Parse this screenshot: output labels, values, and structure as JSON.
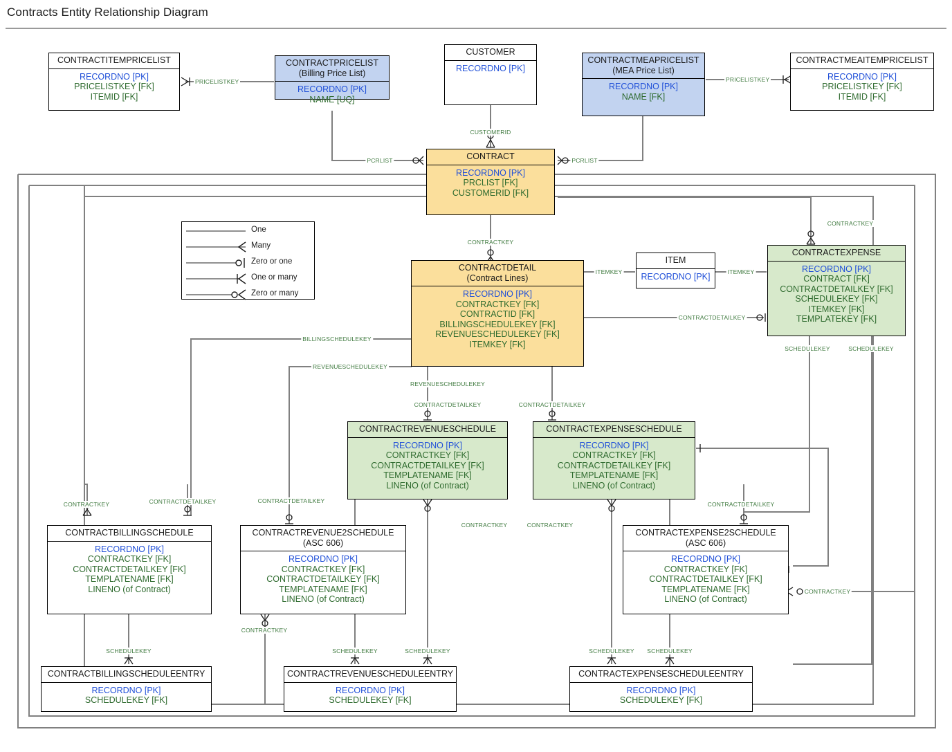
{
  "title": "Contracts Entity Relationship Diagram",
  "colors": {
    "pk": "#1f4fd8",
    "fk": "#2f6b2f",
    "label": "#3f7a3f",
    "blue_entity": "#c2d3f0",
    "orange_entity": "#fbdf9c",
    "green_entity": "#d7e9cb",
    "line": "#808080",
    "border": "#000000"
  },
  "legend": {
    "rows": [
      {
        "symbol": "one",
        "label": "One"
      },
      {
        "symbol": "many",
        "label": "Many"
      },
      {
        "symbol": "zero-or-one",
        "label": "Zero or one"
      },
      {
        "symbol": "one-or-many",
        "label": "One or many"
      },
      {
        "symbol": "zero-or-many",
        "label": "Zero or many"
      }
    ]
  },
  "entities": [
    {
      "id": "contractitempricelist",
      "name": "CONTRACTITEMPRICELIST",
      "subtitle": "",
      "style": "white",
      "attrs": [
        {
          "text": "RECORDNO [PK]",
          "kind": "pk"
        },
        {
          "text": "PRICELISTKEY [FK]",
          "kind": "fk"
        },
        {
          "text": "ITEMID [FK]",
          "kind": "fk"
        }
      ]
    },
    {
      "id": "contractpricelist",
      "name": "CONTRACTPRICELIST",
      "subtitle": "(Billing Price List)",
      "style": "blue",
      "attrs": [
        {
          "text": "RECORDNO [PK]",
          "kind": "pk"
        },
        {
          "text": "NAME [UQ]",
          "kind": "fk"
        }
      ]
    },
    {
      "id": "customer",
      "name": "CUSTOMER",
      "subtitle": "",
      "style": "white",
      "attrs": [
        {
          "text": "RECORDNO [PK]",
          "kind": "pk"
        }
      ]
    },
    {
      "id": "contractmeapricelist",
      "name": "CONTRACTMEAPRICELIST",
      "subtitle": "(MEA Price List)",
      "style": "blue",
      "attrs": [
        {
          "text": "RECORDNO [PK]",
          "kind": "pk"
        },
        {
          "text": "NAME [FK]",
          "kind": "fk"
        }
      ]
    },
    {
      "id": "contractmeaitempricelist",
      "name": "CONTRACTMEAITEMPRICELIST",
      "subtitle": "",
      "style": "white",
      "attrs": [
        {
          "text": "RECORDNO [PK]",
          "kind": "pk"
        },
        {
          "text": "PRICELISTKEY [FK]",
          "kind": "fk"
        },
        {
          "text": "ITEMID [FK]",
          "kind": "fk"
        }
      ]
    },
    {
      "id": "contract",
      "name": "CONTRACT",
      "subtitle": "",
      "style": "orange",
      "attrs": [
        {
          "text": "RECORDNO [PK]",
          "kind": "pk"
        },
        {
          "text": "PRCLIST [FK]",
          "kind": "fk"
        },
        {
          "text": "CUSTOMERID [FK]",
          "kind": "fk"
        }
      ]
    },
    {
      "id": "contractdetail",
      "name": "CONTRACTDETAIL",
      "subtitle": "(Contract Lines)",
      "style": "orange",
      "attrs": [
        {
          "text": "RECORDNO [PK]",
          "kind": "pk"
        },
        {
          "text": "CONTRACTKEY [FK]",
          "kind": "fk"
        },
        {
          "text": "CONTRACTID [FK]",
          "kind": "fk"
        },
        {
          "text": "BILLINGSCHEDULEKEY [FK]",
          "kind": "fk"
        },
        {
          "text": "REVENUESCHEDULEKEY [FK]",
          "kind": "fk"
        },
        {
          "text": "ITEMKEY [FK]",
          "kind": "fk"
        }
      ]
    },
    {
      "id": "item",
      "name": "ITEM",
      "subtitle": "",
      "style": "white",
      "attrs": [
        {
          "text": "RECORDNO [PK]",
          "kind": "pk"
        }
      ]
    },
    {
      "id": "contractexpense",
      "name": "CONTRACTEXPENSE",
      "subtitle": "",
      "style": "green",
      "attrs": [
        {
          "text": "RECORDNO [PK]",
          "kind": "pk"
        },
        {
          "text": "CONTRACT [FK]",
          "kind": "fk"
        },
        {
          "text": "CONTRACTDETAILKEY [FK]",
          "kind": "fk"
        },
        {
          "text": "SCHEDULEKEY [FK]",
          "kind": "fk"
        },
        {
          "text": "ITEMKEY [FK]",
          "kind": "fk"
        },
        {
          "text": "TEMPLATEKEY [FK]",
          "kind": "fk"
        }
      ]
    },
    {
      "id": "contractrevenueschedule",
      "name": "CONTRACTREVENUESCHEDULE",
      "subtitle": "",
      "style": "green",
      "attrs": [
        {
          "text": "RECORDNO [PK]",
          "kind": "pk"
        },
        {
          "text": "CONTRACTKEY [FK]",
          "kind": "fk"
        },
        {
          "text": "CONTRACTDETAILKEY [FK]",
          "kind": "fk"
        },
        {
          "text": "TEMPLATENAME [FK]",
          "kind": "fk"
        },
        {
          "text": "LINENO (of Contract)",
          "kind": "fk"
        }
      ]
    },
    {
      "id": "contractexpenseschedule",
      "name": "CONTRACTEXPENSESCHEDULE",
      "subtitle": "",
      "style": "green",
      "attrs": [
        {
          "text": "RECORDNO [PK]",
          "kind": "pk"
        },
        {
          "text": "CONTRACTKEY [FK]",
          "kind": "fk"
        },
        {
          "text": "CONTRACTDETAILKEY [FK]",
          "kind": "fk"
        },
        {
          "text": "TEMPLATENAME [FK]",
          "kind": "fk"
        },
        {
          "text": "LINENO (of Contract)",
          "kind": "fk"
        }
      ]
    },
    {
      "id": "contractbillingschedule",
      "name": "CONTRACTBILLINGSCHEDULE",
      "subtitle": "",
      "style": "white",
      "attrs": [
        {
          "text": "RECORDNO [PK]",
          "kind": "pk"
        },
        {
          "text": "CONTRACTKEY [FK]",
          "kind": "fk"
        },
        {
          "text": "CONTRACTDETAILKEY  [FK]",
          "kind": "fk"
        },
        {
          "text": "TEMPLATENAME [FK]",
          "kind": "fk"
        },
        {
          "text": "LINENO (of Contract)",
          "kind": "fk"
        }
      ]
    },
    {
      "id": "contractrevenue2schedule",
      "name": "CONTRACTREVENUE2SCHEDULE",
      "subtitle": "(ASC 606)",
      "style": "white",
      "attrs": [
        {
          "text": "RECORDNO [PK]",
          "kind": "pk"
        },
        {
          "text": "CONTRACTKEY [FK]",
          "kind": "fk"
        },
        {
          "text": "CONTRACTDETAILKEY [FK]",
          "kind": "fk"
        },
        {
          "text": "TEMPLATENAME [FK]",
          "kind": "fk"
        },
        {
          "text": "LINENO (of Contract)",
          "kind": "fk"
        }
      ]
    },
    {
      "id": "contractexpense2schedule",
      "name": "CONTRACTEXPENSE2SCHEDULE",
      "subtitle": "(ASC 606)",
      "style": "white",
      "attrs": [
        {
          "text": "RECORDNO [PK]",
          "kind": "pk"
        },
        {
          "text": "CONTRACTKEY [FK]",
          "kind": "fk"
        },
        {
          "text": "CONTRACTDETAILKEY [FK]",
          "kind": "fk"
        },
        {
          "text": "TEMPLATENAME [FK]",
          "kind": "fk"
        },
        {
          "text": "LINENO (of Contract)",
          "kind": "fk"
        }
      ]
    },
    {
      "id": "contractbillingscheduleentry",
      "name": "CONTRACTBILLINGSCHEDULEENTRY",
      "subtitle": "",
      "style": "white",
      "attrs": [
        {
          "text": "RECORDNO [PK]",
          "kind": "pk"
        },
        {
          "text": "SCHEDULEKEY [FK]",
          "kind": "fk"
        }
      ]
    },
    {
      "id": "contractrevenuescheduleentry",
      "name": "CONTRACTREVENUESCHEDULEENTRY",
      "subtitle": "",
      "style": "white",
      "attrs": [
        {
          "text": "RECORDNO [PK]",
          "kind": "pk"
        },
        {
          "text": "SCHEDULEKEY [FK]",
          "kind": "fk"
        }
      ]
    },
    {
      "id": "contractexpensescheduleentry",
      "name": "CONTRACTEXPENSESCHEDULEENTRY",
      "subtitle": "",
      "style": "white",
      "attrs": [
        {
          "text": "RECORDNO [PK]",
          "kind": "pk"
        },
        {
          "text": "SCHEDULEKEY [FK]",
          "kind": "fk"
        }
      ]
    }
  ],
  "edge_labels": [
    {
      "id": "l1",
      "text": "PRICELISTKEY"
    },
    {
      "id": "l2",
      "text": "PRICELISTKEY"
    },
    {
      "id": "l3",
      "text": "CUSTOMERID"
    },
    {
      "id": "l4",
      "text": "PCRLIST"
    },
    {
      "id": "l5",
      "text": "PCRLIST"
    },
    {
      "id": "l6",
      "text": "CONTRACTKEY"
    },
    {
      "id": "l7",
      "text": "CONTRACTKEY"
    },
    {
      "id": "l8",
      "text": "ITEMKEY"
    },
    {
      "id": "l9",
      "text": "ITEMKEY"
    },
    {
      "id": "l10",
      "text": "CONTRACTDETAILKEY"
    },
    {
      "id": "l11",
      "text": "BILLINGSCHEDULEKEY"
    },
    {
      "id": "l12",
      "text": "REVENUESCHEDULEKEY"
    },
    {
      "id": "l13",
      "text": "REVENUESCHEDULEKEY"
    },
    {
      "id": "l14",
      "text": "CONTRACTDETAILKEY"
    },
    {
      "id": "l15",
      "text": "CONTRACTDETAILKEY"
    },
    {
      "id": "l16",
      "text": "SCHEDULEKEY"
    },
    {
      "id": "l17",
      "text": "SCHEDULEKEY"
    },
    {
      "id": "l18",
      "text": "CONTRACTKEY"
    },
    {
      "id": "l19",
      "text": "CONTRACTDETAILKEY"
    },
    {
      "id": "l20",
      "text": "CONTRACTDETAILKEY"
    },
    {
      "id": "l21",
      "text": "CONTRACTDETAILKEY"
    },
    {
      "id": "l22",
      "text": "CONTRACTKEY"
    },
    {
      "id": "l23",
      "text": "CONTRACTKEY"
    },
    {
      "id": "l24",
      "text": "CONTRACTKEY"
    },
    {
      "id": "l25",
      "text": "CONTRACTKEY"
    },
    {
      "id": "l26",
      "text": "SCHEDULEKEY"
    },
    {
      "id": "l27",
      "text": "SCHEDULEKEY"
    },
    {
      "id": "l28",
      "text": "SCHEDULEKEY"
    },
    {
      "id": "l29",
      "text": "SCHEDULEKEY"
    },
    {
      "id": "l30",
      "text": "SCHEDULEKEY"
    },
    {
      "id": "l31",
      "text": "CONTRACTKEY"
    }
  ]
}
